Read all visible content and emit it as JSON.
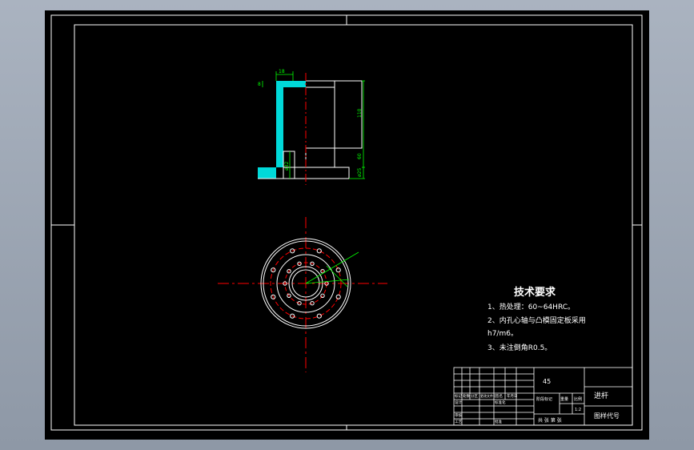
{
  "colors": {
    "background": "#000000",
    "frame": "#ffffff",
    "section_hatch": "#00ffff",
    "dimension": "#00ff00",
    "centerline": "#ff0000"
  },
  "front_view": {
    "dimensions": [
      "18",
      "8",
      "110",
      "60",
      "ø25",
      "ø32"
    ]
  },
  "tech_requirements": {
    "title": "技术要求",
    "lines": [
      "1、热处理：60~64HRC。",
      "2、内孔心轴与凸模固定板采用",
      "h7/m6。",
      "3、未注倒角R0.5。"
    ]
  },
  "title_block": {
    "material": "45",
    "part_name": "进杆",
    "drawing_no_label": "图样代号",
    "scale_label": "比例",
    "scale_value": "1:2",
    "weight_label": "重量",
    "stage_label": "阶段标记",
    "sheet_label": "共   张   第   张",
    "row_labels": [
      "标记",
      "处数",
      "分区",
      "更改文件号",
      "签名",
      "年月日"
    ],
    "designer_label": "设计",
    "standard_label": "标准化",
    "review_label": "审核",
    "process_label": "工艺",
    "approve_label": "批准"
  }
}
